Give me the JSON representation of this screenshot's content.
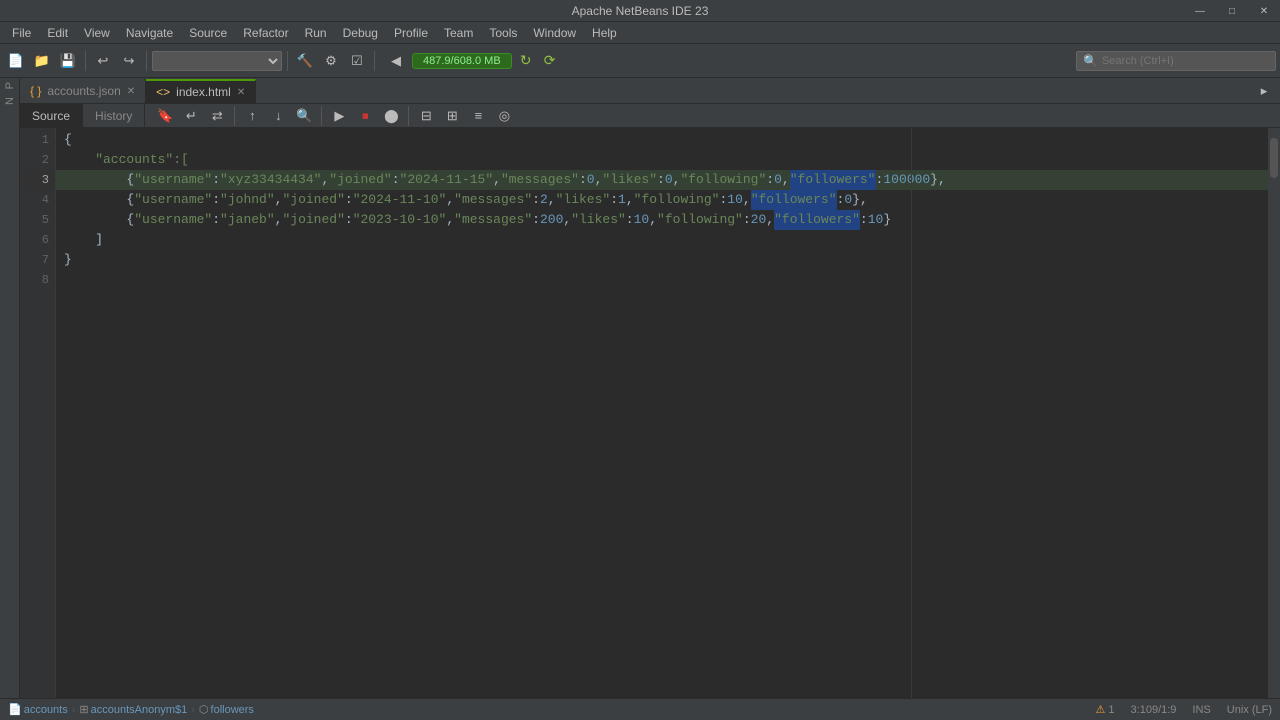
{
  "app": {
    "title": "Apache NetBeans IDE 23"
  },
  "menu": {
    "items": [
      "File",
      "Edit",
      "View",
      "Navigate",
      "Source",
      "Refactor",
      "Run",
      "Debug",
      "Profile",
      "Team",
      "Tools",
      "Window",
      "Help"
    ]
  },
  "tabs": [
    {
      "label": "accounts.json",
      "active": false,
      "icon": "json-icon"
    },
    {
      "label": "index.html",
      "active": true,
      "icon": "html-icon"
    }
  ],
  "editor_tabs": [
    {
      "label": "Source",
      "active": true
    },
    {
      "label": "History",
      "active": false
    }
  ],
  "toolbar": {
    "run_label": "487.9/608.0 MB",
    "search_placeholder": "Search (Ctrl+I)"
  },
  "code": {
    "lines": [
      {
        "number": 1,
        "content": [
          {
            "type": "brace",
            "text": "{"
          }
        ]
      },
      {
        "number": 2,
        "content": [
          {
            "type": "key",
            "text": "    \"accounts\":["
          }
        ]
      },
      {
        "number": 3,
        "highlighted": true,
        "content": [
          {
            "type": "punct",
            "text": "        {"
          },
          {
            "type": "key",
            "text": "\"username\""
          },
          {
            "type": "punct",
            "text": ":"
          },
          {
            "type": "value-str",
            "text": "\"xyz33434434\""
          },
          {
            "type": "punct",
            "text": ", "
          },
          {
            "type": "key",
            "text": "\"joined\""
          },
          {
            "type": "punct",
            "text": ":"
          },
          {
            "type": "value-str",
            "text": "\"2024-11-15\""
          },
          {
            "type": "punct",
            "text": ", "
          },
          {
            "type": "key",
            "text": "\"messages\""
          },
          {
            "type": "punct",
            "text": ":"
          },
          {
            "type": "value-num",
            "text": "0"
          },
          {
            "type": "punct",
            "text": ", "
          },
          {
            "type": "key",
            "text": "\"likes\""
          },
          {
            "type": "punct",
            "text": ":"
          },
          {
            "type": "value-num",
            "text": "0"
          },
          {
            "type": "punct",
            "text": ", "
          },
          {
            "type": "key",
            "text": "\"following\""
          },
          {
            "type": "punct",
            "text": ":"
          },
          {
            "type": "value-num",
            "text": "0"
          },
          {
            "type": "punct",
            "text": ", "
          },
          {
            "type": "key selected",
            "text": "\"followers\""
          },
          {
            "type": "punct",
            "text": ":"
          },
          {
            "type": "value-num",
            "text": "100000"
          },
          {
            "type": "punct",
            "text": "},"
          }
        ]
      },
      {
        "number": 4,
        "content": [
          {
            "type": "punct",
            "text": "        {"
          },
          {
            "type": "key",
            "text": "\"username\""
          },
          {
            "type": "punct",
            "text": ":"
          },
          {
            "type": "value-str",
            "text": "\"johnd\""
          },
          {
            "type": "punct",
            "text": ", "
          },
          {
            "type": "key",
            "text": "\"joined\""
          },
          {
            "type": "punct",
            "text": ":"
          },
          {
            "type": "value-str",
            "text": "\"2024-11-10\""
          },
          {
            "type": "punct",
            "text": ", "
          },
          {
            "type": "key",
            "text": "\"messages\""
          },
          {
            "type": "punct",
            "text": ":"
          },
          {
            "type": "value-num",
            "text": "2"
          },
          {
            "type": "punct",
            "text": ", "
          },
          {
            "type": "key",
            "text": "\"likes\""
          },
          {
            "type": "punct",
            "text": ":"
          },
          {
            "type": "value-num",
            "text": "1"
          },
          {
            "type": "punct",
            "text": ", "
          },
          {
            "type": "key",
            "text": "\"following\""
          },
          {
            "type": "punct",
            "text": ":"
          },
          {
            "type": "value-num",
            "text": "10"
          },
          {
            "type": "punct",
            "text": ", "
          },
          {
            "type": "key selected",
            "text": "\"followers\""
          },
          {
            "type": "punct",
            "text": ":"
          },
          {
            "type": "value-num",
            "text": "0"
          },
          {
            "type": "punct",
            "text": "},"
          }
        ]
      },
      {
        "number": 5,
        "content": [
          {
            "type": "punct",
            "text": "        {"
          },
          {
            "type": "key",
            "text": "\"username\""
          },
          {
            "type": "punct",
            "text": ":"
          },
          {
            "type": "value-str",
            "text": "\"janeb\""
          },
          {
            "type": "punct",
            "text": ", "
          },
          {
            "type": "key",
            "text": "\"joined\""
          },
          {
            "type": "punct",
            "text": ":"
          },
          {
            "type": "value-str",
            "text": "\"2023-10-10\""
          },
          {
            "type": "punct",
            "text": ", "
          },
          {
            "type": "key",
            "text": "\"messages\""
          },
          {
            "type": "punct",
            "text": ":"
          },
          {
            "type": "value-num",
            "text": "200"
          },
          {
            "type": "punct",
            "text": ", "
          },
          {
            "type": "key",
            "text": "\"likes\""
          },
          {
            "type": "punct",
            "text": ":"
          },
          {
            "type": "value-num",
            "text": "10"
          },
          {
            "type": "punct",
            "text": ", "
          },
          {
            "type": "key",
            "text": "\"following\""
          },
          {
            "type": "punct",
            "text": ":"
          },
          {
            "type": "value-num",
            "text": "20"
          },
          {
            "type": "punct",
            "text": ", "
          },
          {
            "type": "key selected",
            "text": "\"followers\""
          },
          {
            "type": "punct",
            "text": ":"
          },
          {
            "type": "value-num",
            "text": "10"
          },
          {
            "type": "punct",
            "text": "}"
          }
        ]
      },
      {
        "number": 6,
        "content": [
          {
            "type": "brace",
            "text": "    ]"
          }
        ]
      },
      {
        "number": 7,
        "content": [
          {
            "type": "brace",
            "text": "}"
          }
        ]
      },
      {
        "number": 8,
        "content": []
      }
    ]
  },
  "status_bar": {
    "breadcrumb": [
      "accounts",
      "accountsAnonym$1",
      "followers"
    ],
    "position": "3:109/1:9",
    "mode": "INS",
    "encoding": "Unix (LF)"
  },
  "window_controls": {
    "minimize": "—",
    "maximize": "□",
    "close": "✕"
  }
}
